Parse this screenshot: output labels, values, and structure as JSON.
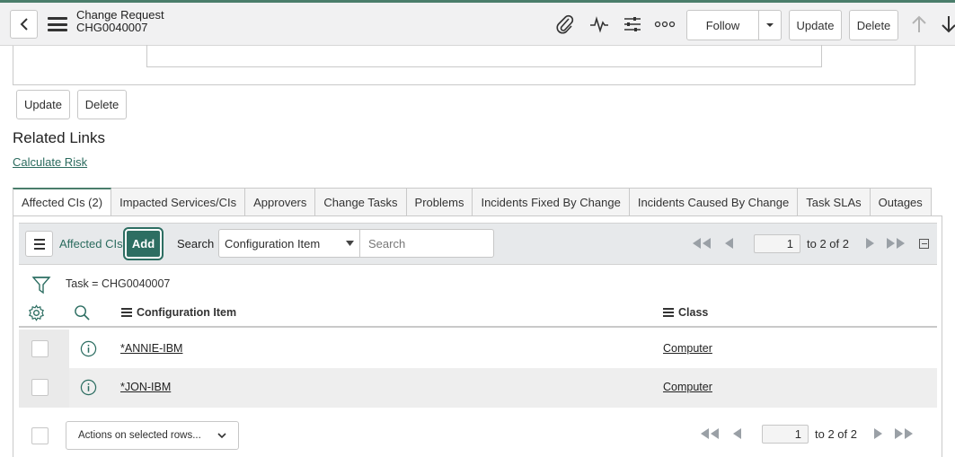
{
  "header": {
    "title": "Change Request",
    "record_number": "CHG0040007",
    "follow_label": "Follow",
    "update_label": "Update",
    "delete_label": "Delete",
    "icons": [
      "back-icon",
      "menu-icon",
      "paperclip-icon",
      "activity-icon",
      "settings-sliders-icon",
      "more-icon",
      "chevron-down-icon",
      "arrow-up-icon",
      "arrow-down-icon"
    ]
  },
  "form_actions": {
    "update_label": "Update",
    "delete_label": "Delete"
  },
  "related_links": {
    "title": "Related Links",
    "calculate_risk": "Calculate Risk"
  },
  "tabs": [
    {
      "label": "Affected CIs (2)",
      "active": true
    },
    {
      "label": "Impacted Services/CIs"
    },
    {
      "label": "Approvers"
    },
    {
      "label": "Change Tasks"
    },
    {
      "label": "Problems"
    },
    {
      "label": "Incidents Fixed By Change"
    },
    {
      "label": "Incidents Caused By Change"
    },
    {
      "label": "Task SLAs"
    },
    {
      "label": "Outages"
    }
  ],
  "list": {
    "title": "Affected CIs",
    "add_label": "Add",
    "search_label": "Search",
    "search_field": "Configuration Item",
    "search_placeholder": "Search",
    "pager_top": {
      "page": "1",
      "range": "to 2 of 2"
    },
    "pager_bottom": {
      "page": "1",
      "range": "to 2 of 2"
    },
    "filter": "Task = CHG0040007",
    "columns": [
      "Configuration Item",
      "Class"
    ],
    "rows": [
      {
        "ci": "*ANNIE-IBM",
        "class": "Computer"
      },
      {
        "ci": "*JON-IBM",
        "class": "Computer"
      }
    ],
    "actions_select": "Actions on selected rows..."
  },
  "colors": {
    "accent": "#2d6e62",
    "link": "#2b6b5e",
    "topbar_bg": "#f1f1f2"
  }
}
